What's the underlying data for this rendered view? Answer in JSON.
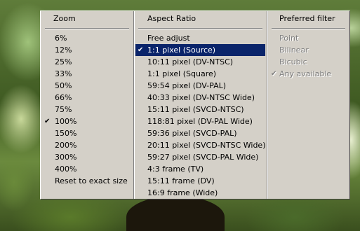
{
  "zoom": {
    "header": "Zoom",
    "items": [
      {
        "label": "6%",
        "checked": false
      },
      {
        "label": "12%",
        "checked": false
      },
      {
        "label": "25%",
        "checked": false
      },
      {
        "label": "33%",
        "checked": false
      },
      {
        "label": "50%",
        "checked": false
      },
      {
        "label": "66%",
        "checked": false
      },
      {
        "label": "75%",
        "checked": false
      },
      {
        "label": "100%",
        "checked": true
      },
      {
        "label": "150%",
        "checked": false
      },
      {
        "label": "200%",
        "checked": false
      },
      {
        "label": "300%",
        "checked": false
      },
      {
        "label": "400%",
        "checked": false
      },
      {
        "label": "Reset to exact size",
        "checked": false
      }
    ]
  },
  "aspect": {
    "header": "Aspect Ratio",
    "items": [
      {
        "label": "Free adjust",
        "checked": false,
        "selected": false
      },
      {
        "label": "1:1 pixel (Source)",
        "checked": true,
        "selected": true
      },
      {
        "label": "10:11 pixel (DV-NTSC)",
        "checked": false,
        "selected": false
      },
      {
        "label": "1:1 pixel (Square)",
        "checked": false,
        "selected": false
      },
      {
        "label": "59:54 pixel (DV-PAL)",
        "checked": false,
        "selected": false
      },
      {
        "label": "40:33 pixel (DV-NTSC Wide)",
        "checked": false,
        "selected": false
      },
      {
        "label": "15:11 pixel (SVCD-NTSC)",
        "checked": false,
        "selected": false
      },
      {
        "label": "118:81 pixel (DV-PAL Wide)",
        "checked": false,
        "selected": false
      },
      {
        "label": "59:36 pixel (SVCD-PAL)",
        "checked": false,
        "selected": false
      },
      {
        "label": "20:11 pixel (SVCD-NTSC Wide)",
        "checked": false,
        "selected": false
      },
      {
        "label": "59:27 pixel (SVCD-PAL Wide)",
        "checked": false,
        "selected": false
      },
      {
        "label": "4:3 frame (TV)",
        "checked": false,
        "selected": false
      },
      {
        "label": "15:11 frame (DV)",
        "checked": false,
        "selected": false
      },
      {
        "label": "16:9 frame (Wide)",
        "checked": false,
        "selected": false
      }
    ]
  },
  "filter": {
    "header": "Preferred filter",
    "items": [
      {
        "label": "Point",
        "checked": false,
        "disabled": true
      },
      {
        "label": "Bilinear",
        "checked": false,
        "disabled": true
      },
      {
        "label": "Bicubic",
        "checked": false,
        "disabled": true
      },
      {
        "label": "Any available",
        "checked": true,
        "disabled": true
      }
    ]
  },
  "check_glyph": "✔",
  "colors": {
    "menu_bg": "#d4d0c8",
    "highlight": "#0a246a",
    "disabled_text": "#808080"
  }
}
